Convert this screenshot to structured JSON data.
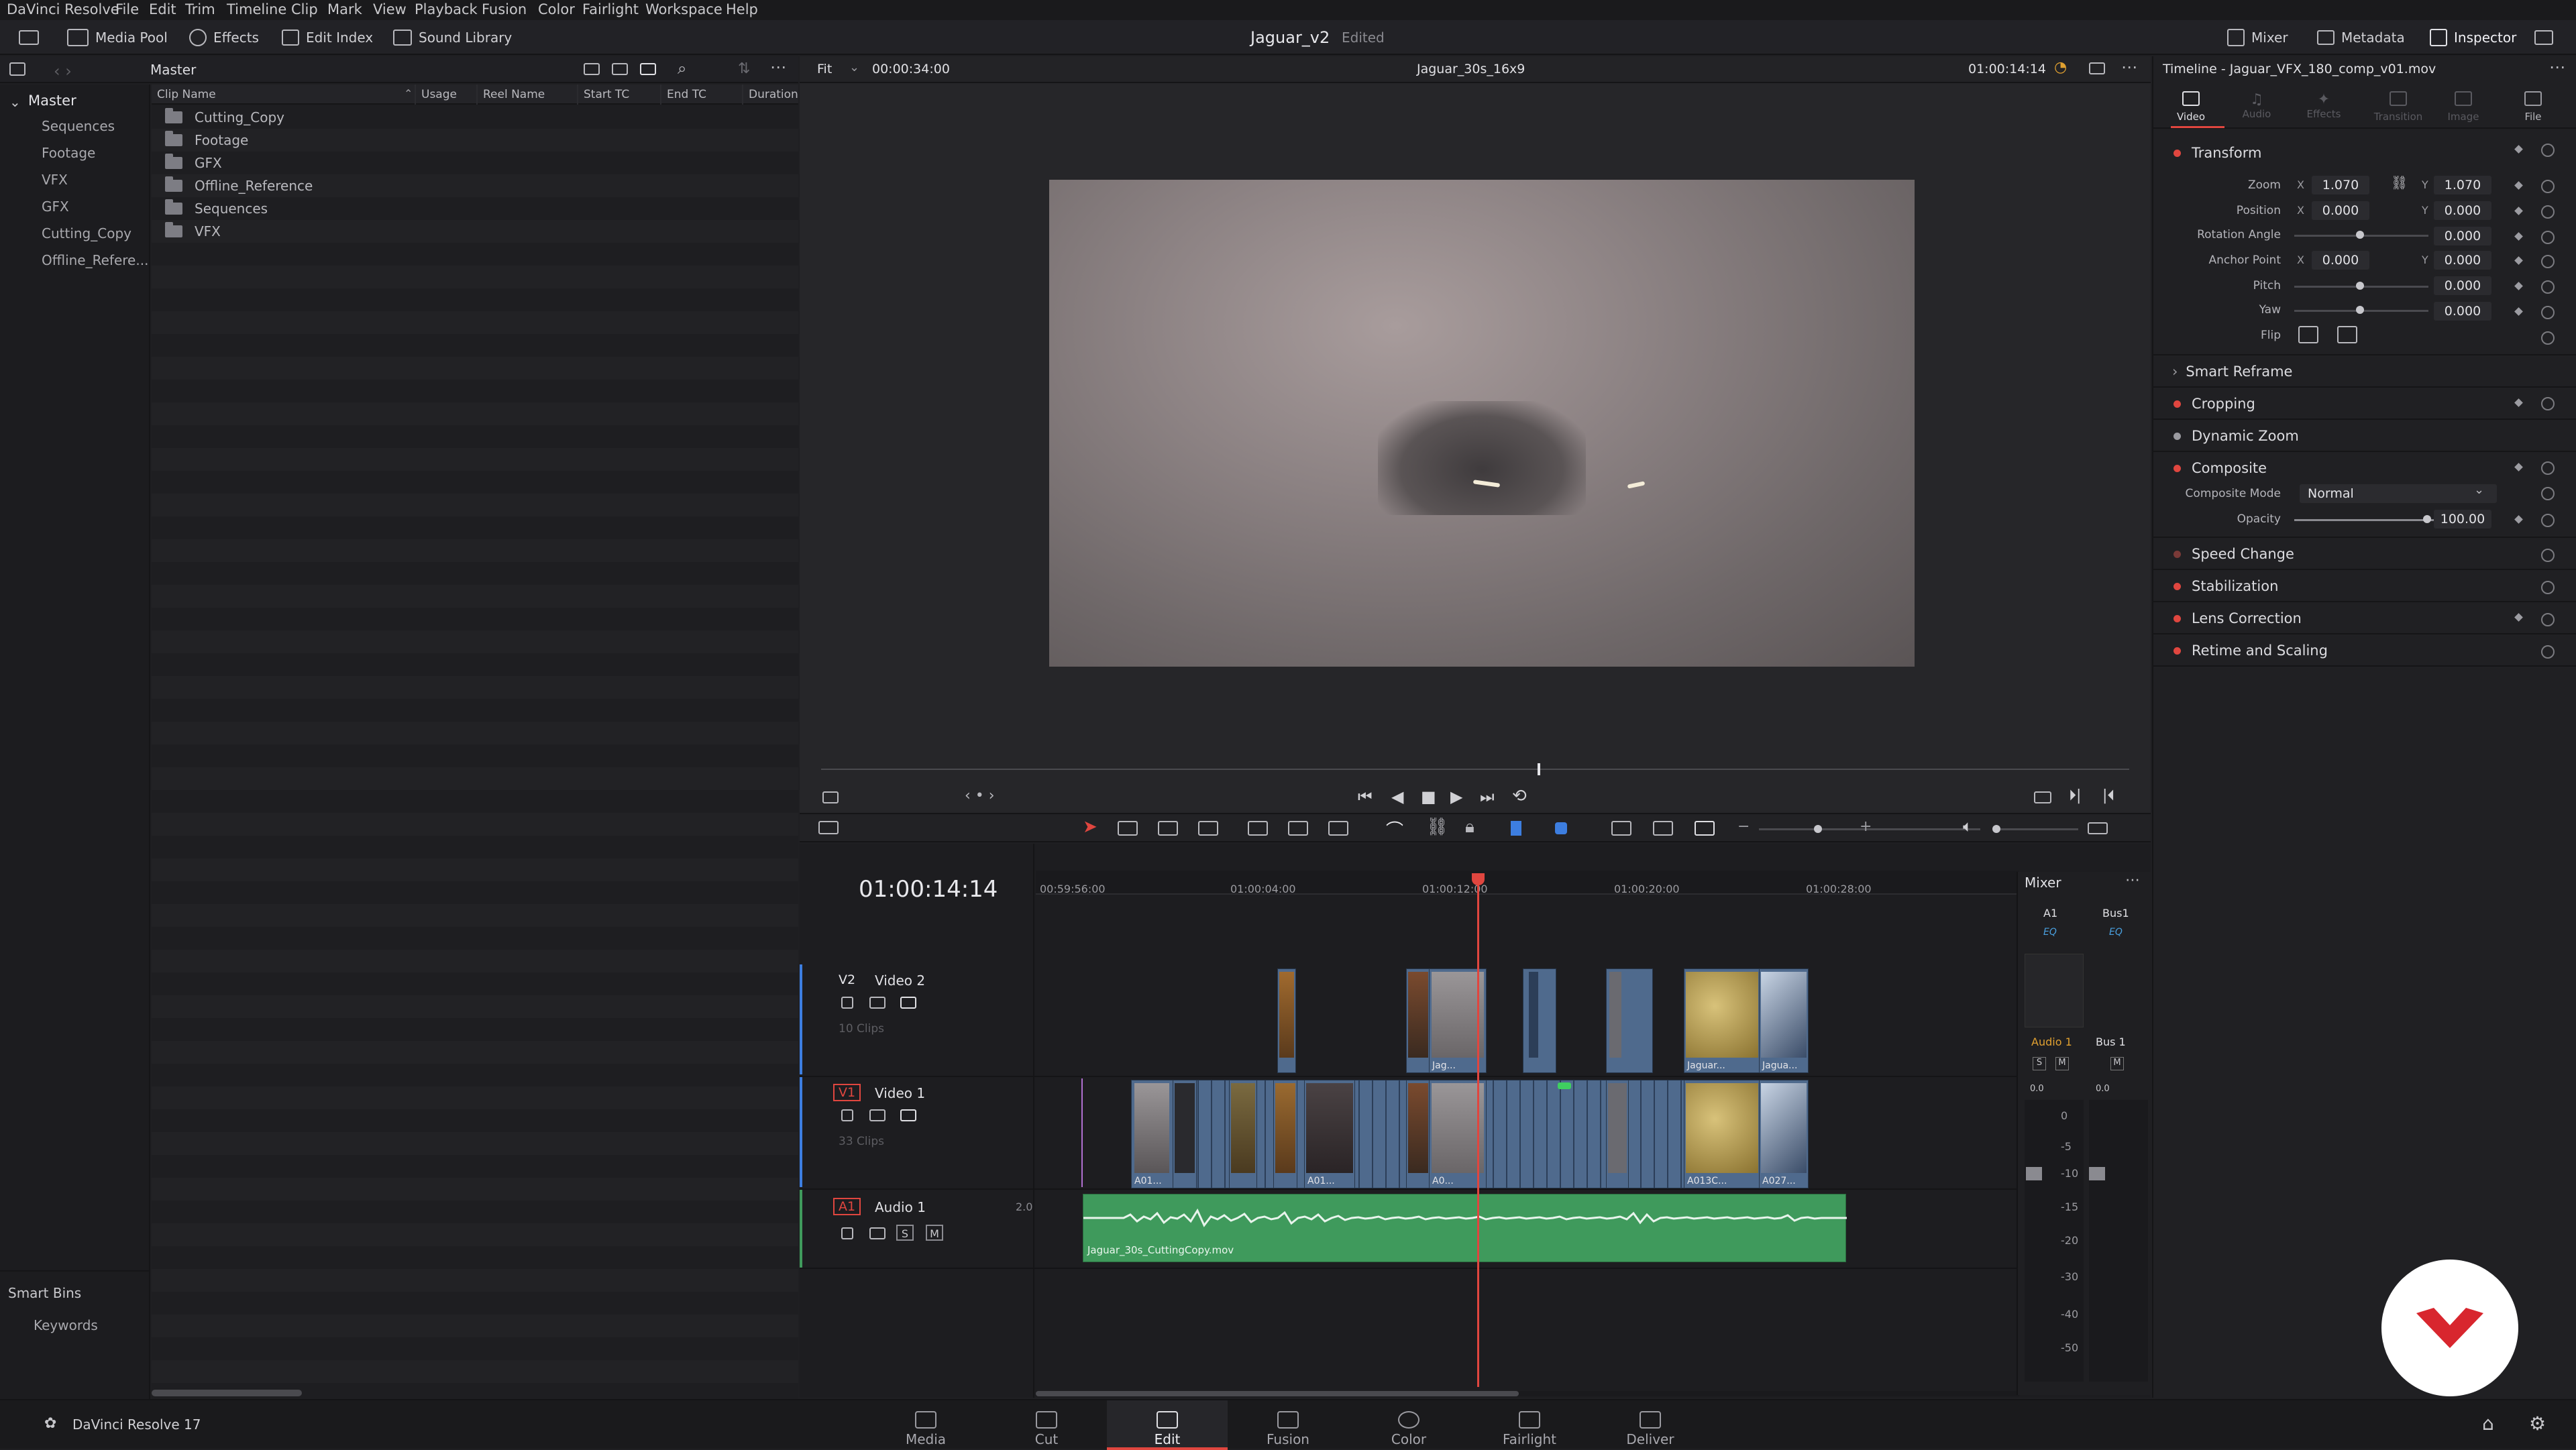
{
  "menu": [
    "DaVinci Resolve",
    "File",
    "Edit",
    "Trim",
    "Timeline",
    "Clip",
    "Mark",
    "View",
    "Playback",
    "Fusion",
    "Color",
    "Fairlight",
    "Workspace",
    "Help"
  ],
  "header": {
    "media_pool": "Media Pool",
    "effects": "Effects",
    "edit_index": "Edit Index",
    "sound_library": "Sound Library",
    "project_title": "Jaguar_v2",
    "project_status": "Edited",
    "mixer": "Mixer",
    "metadata": "Metadata",
    "inspector": "Inspector"
  },
  "media_pool": {
    "bin_title": "Master",
    "bins_root": "Master",
    "bins": [
      "Sequences",
      "Footage",
      "VFX",
      "GFX",
      "Cutting_Copy",
      "Offline_Refere..."
    ],
    "smart_bins": "Smart Bins",
    "keywords": "Keywords",
    "columns": [
      "Clip Name",
      "Usage",
      "Reel Name",
      "Start TC",
      "End TC",
      "Duration"
    ],
    "clips": [
      "Cutting_Copy",
      "Footage",
      "GFX",
      "Offline_Reference",
      "Sequences",
      "VFX"
    ]
  },
  "viewer": {
    "fit": "Fit",
    "source_tc": "00:00:34:00",
    "timeline_name": "Jaguar_30s_16x9",
    "record_tc": "01:00:14:14"
  },
  "timeline": {
    "timecode": "01:00:14:14",
    "ruler": [
      "00:59:56:00",
      "01:00:04:00",
      "01:00:12:00",
      "01:00:20:00",
      "01:00:28:00"
    ],
    "tracks": [
      {
        "id": "V2",
        "name": "Video 2",
        "clips": "10 Clips"
      },
      {
        "id": "V1",
        "name": "Video 1",
        "clips": "33 Clips"
      },
      {
        "id": "A1",
        "name": "Audio 1",
        "format": "2.0"
      }
    ],
    "clip_labels": [
      "Jag...",
      "Jaguar...",
      "Jagua...",
      "A01...",
      "A01...",
      "A0...",
      "A013C...",
      "A027..."
    ],
    "audio_clip": "Jaguar_30s_CuttingCopy.mov"
  },
  "mixer": {
    "title": "Mixer",
    "channels": [
      "A1",
      "Bus1"
    ],
    "eq": "EQ",
    "strip_names": [
      "Audio 1",
      "Bus 1"
    ],
    "levels": [
      "0.0",
      "0.0"
    ],
    "scale": [
      "0",
      "-5",
      "-10",
      "-15",
      "-20",
      "-30",
      "-40",
      "-50"
    ]
  },
  "inspector": {
    "title": "Timeline - Jaguar_VFX_180_comp_v01.mov",
    "tabs": [
      "Video",
      "Audio",
      "Effects",
      "Transition",
      "Image",
      "File"
    ],
    "transform": "Transform",
    "params": {
      "zoom": {
        "label": "Zoom",
        "x": "1.070",
        "y": "1.070"
      },
      "position": {
        "label": "Position",
        "x": "0.000",
        "y": "0.000"
      },
      "rotation": {
        "label": "Rotation Angle",
        "value": "0.000"
      },
      "anchor": {
        "label": "Anchor Point",
        "x": "0.000",
        "y": "0.000"
      },
      "pitch": {
        "label": "Pitch",
        "value": "0.000"
      },
      "yaw": {
        "label": "Yaw",
        "value": "0.000"
      },
      "flip": {
        "label": "Flip"
      }
    },
    "smart_reframe": "Smart Reframe",
    "cropping": "Cropping",
    "dynamic_zoom": "Dynamic Zoom",
    "composite": "Composite",
    "composite_mode_label": "Composite Mode",
    "composite_mode": "Normal",
    "opacity_label": "Opacity",
    "opacity": "100.00",
    "speed_change": "Speed Change",
    "stabilization": "Stabilization",
    "lens_correction": "Lens Correction",
    "retime": "Retime and Scaling"
  },
  "footer": {
    "app": "DaVinci Resolve 17",
    "pages": [
      "Media",
      "Cut",
      "Edit",
      "Fusion",
      "Color",
      "Fairlight",
      "Deliver"
    ],
    "active_page": "Edit"
  },
  "colors": {
    "accent": "#e0463f",
    "audio_clip": "#3f9a5c",
    "video_clip": "#4f6a8d",
    "playhead": "#e0463f"
  },
  "watermark_logo": "red-circle-logo"
}
